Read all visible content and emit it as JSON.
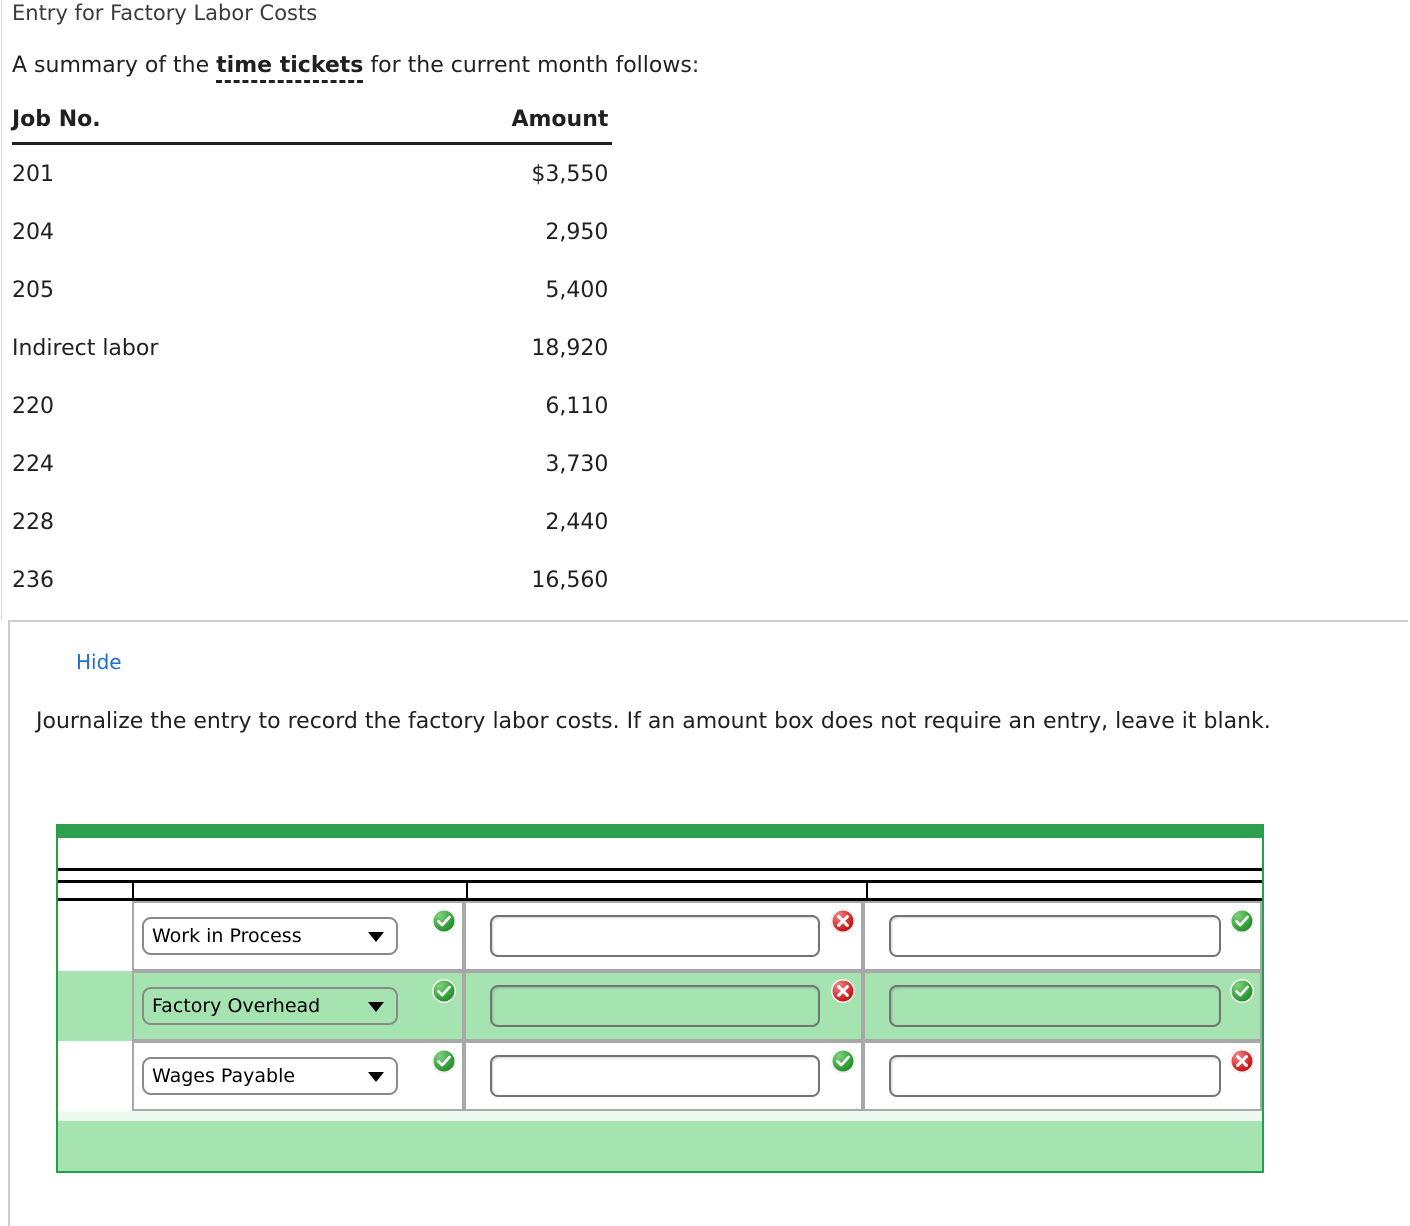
{
  "problem": {
    "title": "Entry for Factory Labor Costs",
    "lead_before": "A summary of the ",
    "lead_term": "time tickets",
    "lead_after": " for the current month follows:"
  },
  "amount_table": {
    "headers": [
      "Job No.",
      "Amount"
    ],
    "rows": [
      {
        "job": "201",
        "amount": "$3,550"
      },
      {
        "job": "204",
        "amount": "2,950"
      },
      {
        "job": "205",
        "amount": "5,400"
      },
      {
        "job": "Indirect labor",
        "amount": "18,920"
      },
      {
        "job": "220",
        "amount": "6,110"
      },
      {
        "job": "224",
        "amount": "3,730"
      },
      {
        "job": "228",
        "amount": "2,440"
      },
      {
        "job": "236",
        "amount": "16,560"
      }
    ]
  },
  "answer_panel": {
    "hide_label": "Hide",
    "instruction": "Journalize the entry to record the factory labor costs. If an amount box does not require an entry, leave it blank."
  },
  "journal": {
    "rows": [
      {
        "account": "Work in Process",
        "account_status": "ok",
        "debit_value": "",
        "debit_status": "bad",
        "credit_value": "",
        "credit_status": "ok",
        "tint": "light"
      },
      {
        "account": "Factory Overhead",
        "account_status": "ok",
        "debit_value": "",
        "debit_status": "bad",
        "credit_value": "",
        "credit_status": "ok",
        "tint": "strong"
      },
      {
        "account": "Wages Payable",
        "account_status": "ok",
        "debit_value": "",
        "debit_status": "ok",
        "credit_value": "",
        "credit_status": "bad",
        "tint": "light"
      }
    ],
    "input_placeholder": "",
    "colors": {
      "header_green": "#2ea04d",
      "row_highlight_green": "#a5e3b0",
      "row_light_green": "#edf9ef",
      "border_green": "#22a04a",
      "status_ok": "#2f9a33",
      "status_bad": "#cf2020",
      "link_blue": "#1f6fc4"
    }
  }
}
